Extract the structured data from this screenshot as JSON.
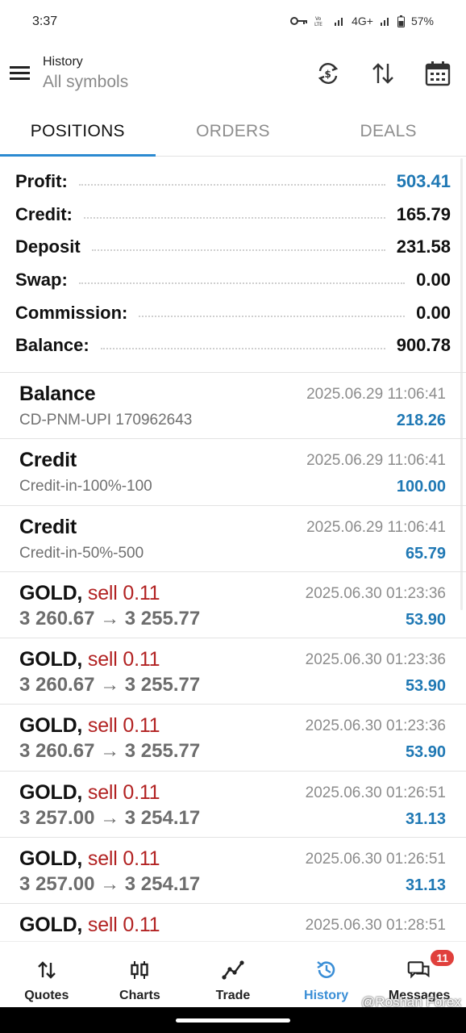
{
  "status_bar": {
    "time": "3:37",
    "network": "4G+",
    "battery": "57%",
    "icons": [
      "key-icon",
      "volte-icon",
      "signal-icon",
      "signal-icon",
      "battery-icon"
    ]
  },
  "header": {
    "title": "History",
    "subtitle": "All symbols",
    "actions": [
      "currency-exchange-icon",
      "sort-icon",
      "calendar-icon"
    ]
  },
  "tabs": [
    {
      "label": "POSITIONS",
      "active": true
    },
    {
      "label": "ORDERS",
      "active": false
    },
    {
      "label": "DEALS",
      "active": false
    }
  ],
  "summary": [
    {
      "label": "Profit:",
      "value": "503.41",
      "highlight": true
    },
    {
      "label": "Credit:",
      "value": "165.79",
      "highlight": false
    },
    {
      "label": "Deposit",
      "value": "231.58",
      "highlight": false
    },
    {
      "label": "Swap:",
      "value": "0.00",
      "highlight": false
    },
    {
      "label": "Commission:",
      "value": "0.00",
      "highlight": false
    },
    {
      "label": "Balance:",
      "value": "900.78",
      "highlight": false
    }
  ],
  "deals": [
    {
      "name": "Balance",
      "side": "",
      "sub": "CD-PNM-UPI 170962643",
      "time": "2025.06.29 11:06:41",
      "profit": "218.26",
      "kind": "op"
    },
    {
      "name": "Credit",
      "side": "",
      "sub": "Credit-in-100%-100",
      "time": "2025.06.29 11:06:41",
      "profit": "100.00",
      "kind": "op"
    },
    {
      "name": "Credit",
      "side": "",
      "sub": "Credit-in-50%-500",
      "time": "2025.06.29 11:06:41",
      "profit": "65.79",
      "kind": "op"
    },
    {
      "name": "GOLD,",
      "side": "sell 0.11",
      "sub": "3 260.67 → 3 255.77",
      "time": "2025.06.30 01:23:36",
      "profit": "53.90",
      "kind": "trade"
    },
    {
      "name": "GOLD,",
      "side": "sell 0.11",
      "sub": "3 260.67 → 3 255.77",
      "time": "2025.06.30 01:23:36",
      "profit": "53.90",
      "kind": "trade"
    },
    {
      "name": "GOLD,",
      "side": "sell 0.11",
      "sub": "3 260.67 → 3 255.77",
      "time": "2025.06.30 01:23:36",
      "profit": "53.90",
      "kind": "trade"
    },
    {
      "name": "GOLD,",
      "side": "sell 0.11",
      "sub": "3 257.00 → 3 254.17",
      "time": "2025.06.30 01:26:51",
      "profit": "31.13",
      "kind": "trade"
    },
    {
      "name": "GOLD,",
      "side": "sell 0.11",
      "sub": "3 257.00 → 3 254.17",
      "time": "2025.06.30 01:26:51",
      "profit": "31.13",
      "kind": "trade"
    },
    {
      "name": "GOLD,",
      "side": "sell 0.11",
      "sub": "",
      "time": "2025.06.30 01:28:51",
      "profit": "",
      "kind": "trade"
    }
  ],
  "bottom_nav": [
    {
      "label": "Quotes",
      "icon": "quotes-icon",
      "active": false
    },
    {
      "label": "Charts",
      "icon": "charts-icon",
      "active": false
    },
    {
      "label": "Trade",
      "icon": "trade-icon",
      "active": false
    },
    {
      "label": "History",
      "icon": "history-icon",
      "active": true
    },
    {
      "label": "Messages",
      "icon": "messages-icon",
      "active": false,
      "badge": "11"
    }
  ],
  "watermark": "@Roshan Forex",
  "colors": {
    "accent": "#2b8ad1",
    "profit": "#1f78b4",
    "sell": "#b22222"
  }
}
